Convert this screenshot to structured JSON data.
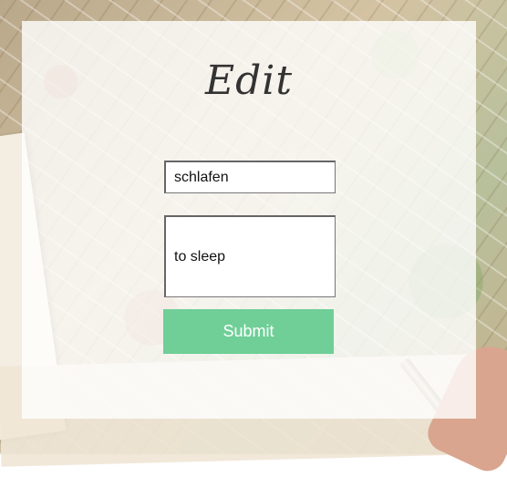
{
  "page": {
    "title": "Edit"
  },
  "form": {
    "word_value": "schlafen",
    "meaning_value": "to sleep",
    "submit_label": "Submit"
  },
  "colors": {
    "submit_bg": "#6fcf97",
    "panel_bg": "rgba(255,255,255,0.80)"
  }
}
